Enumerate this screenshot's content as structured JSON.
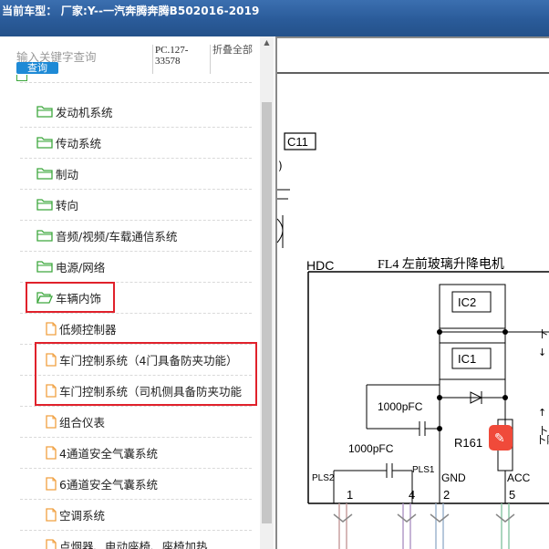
{
  "titlebar": {
    "text": "当前车型： 厂家:Y--一汽奔腾奔腾B502016-2019"
  },
  "search": {
    "placeholder": "输入关键字查询",
    "button_label": "查询"
  },
  "pc_label": "PC.127-33578",
  "fold_label": "折叠全部",
  "tree": {
    "items": [
      {
        "label": "发动机系统",
        "type": "folder"
      },
      {
        "label": "传动系统",
        "type": "folder"
      },
      {
        "label": "制动",
        "type": "folder"
      },
      {
        "label": "转向",
        "type": "folder"
      },
      {
        "label": "音频/视频/车载通信系统",
        "type": "folder"
      },
      {
        "label": "电源/网络",
        "type": "folder"
      },
      {
        "label": "车辆内饰",
        "type": "folder-open"
      },
      {
        "label": "低频控制器",
        "type": "file"
      },
      {
        "label": "车门控制系统（4门具备防夹功能）",
        "type": "file"
      },
      {
        "label": "车门控制系统（司机侧具备防夹功能",
        "type": "file"
      },
      {
        "label": "组合仪表",
        "type": "file"
      },
      {
        "label": "4通道安全气囊系统",
        "type": "file"
      },
      {
        "label": "6通道安全气囊系统",
        "type": "file"
      },
      {
        "label": "空调系统",
        "type": "file"
      },
      {
        "label": "点烟器、电动座椅、座椅加热",
        "type": "file"
      }
    ]
  },
  "diagram": {
    "connector": "C11",
    "module_label": "HDC",
    "motor_label": "FL4 左前玻璃升降电机",
    "ic_labels": [
      "IC2",
      "IC1"
    ],
    "capacitor_labels": [
      "1000pFC",
      "1000pFC"
    ],
    "resistor_label": "R161",
    "pins": [
      {
        "name": "PLS2",
        "number": "1"
      },
      {
        "name": "PLS1",
        "number": "4"
      },
      {
        "name": "GND",
        "number": "2"
      },
      {
        "name": "ACC",
        "number": "5"
      }
    ],
    "side_labels": [
      "卜",
      "卜",
      "卜阝"
    ]
  },
  "colors": {
    "highlight": "#e0212b",
    "titlebar": "#2a5b99",
    "accent": "#1e8ad6",
    "folder": "#3ea83e",
    "file": "#f0a040"
  }
}
